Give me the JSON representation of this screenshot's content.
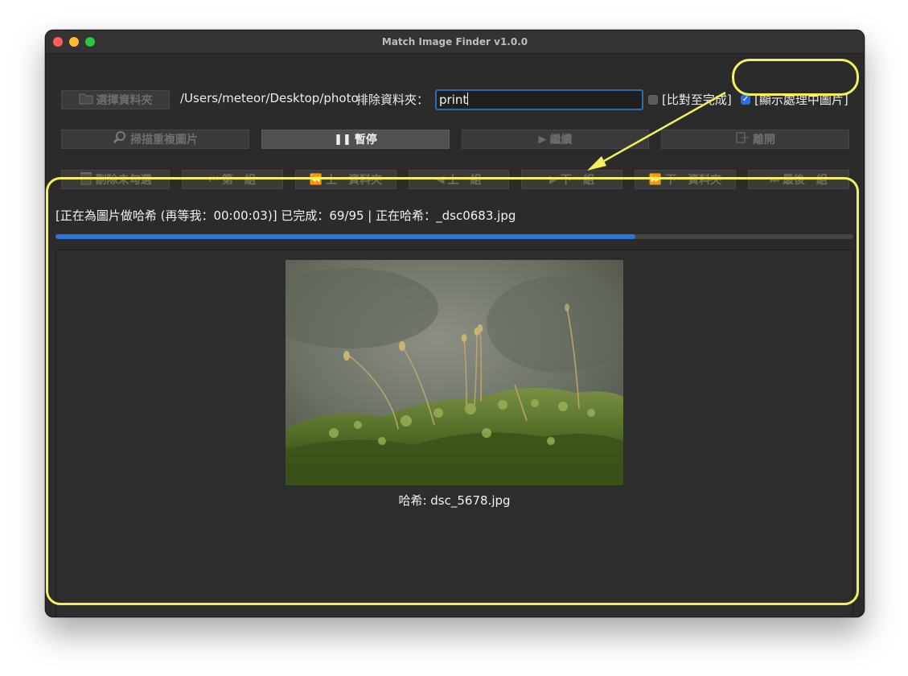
{
  "window": {
    "title": "Match Image Finder v1.0.0"
  },
  "toolbar": {
    "select_folder_label": "選擇資料夾",
    "folder_path": "/Users/meteor/Desktop/photo",
    "exclude_label": "排除資料夾：",
    "exclude_value": "print",
    "compare_to_end_label": "[比對至完成]",
    "compare_to_end_checked": false,
    "show_processing_label": "[顯示處理中圖片]",
    "show_processing_checked": true
  },
  "actions": {
    "scan_label": "掃描重複圖片",
    "pause_label": "暫停",
    "continue_label": "繼續",
    "leave_label": "離開"
  },
  "navigation": {
    "delete_unchecked_label": "刪除未勾選",
    "first_group_label": "第一組",
    "prev_folder_label": "上一資料夾",
    "prev_group_label": "上一組",
    "next_group_label": "下一組",
    "next_folder_label": "下一資料夾",
    "last_group_label": "最後一組"
  },
  "status": {
    "text": "[正在為圖片做哈希 (再等我：00:00:03)] 已完成：69/95 | 正在哈希：_dsc0683.jpg",
    "progress_done": 69,
    "progress_total": 95
  },
  "preview": {
    "caption": "哈希: dsc_5678.jpg"
  },
  "colors": {
    "accent": "#2f74d9",
    "annotation": "#f4f05a",
    "window_bg": "#2b2b2b"
  },
  "icons": {
    "folder": "folder-icon",
    "magnifier": "magnifier-icon",
    "pause": "pause-icon",
    "play": "play-icon",
    "exit": "exit-icon",
    "trash": "trash-icon",
    "first": "skip-first-icon",
    "rewind": "rewind-icon",
    "prev": "prev-icon",
    "next": "next-icon",
    "fast_forward": "fast-forward-icon",
    "last": "skip-last-icon"
  }
}
